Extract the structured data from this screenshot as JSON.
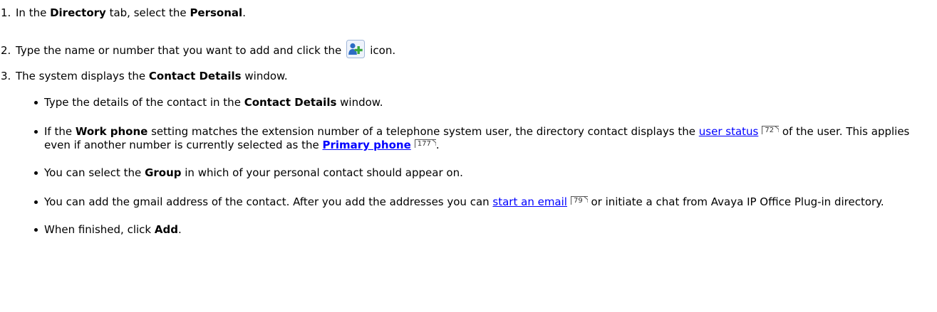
{
  "steps": [
    {
      "number": "1.",
      "text1": "In the ",
      "bold1": "Directory",
      "text2": " tab, select the ",
      "bold2": "Personal",
      "text3": "."
    },
    {
      "number": "2.",
      "text1": "Type the name or number that you want to add and click the",
      "icon": "add-contact-icon",
      "text2": "icon."
    },
    {
      "number": "3.",
      "text1": "The system displays the ",
      "bold1": "Contact Details",
      "text2": " window."
    }
  ],
  "bullets": [
    {
      "text1": "Type the details of the contact in the ",
      "bold1": "Contact Details",
      "text2": " window."
    },
    {
      "text1": "If the ",
      "bold1": "Work phone",
      "text2": " setting matches the extension number of a telephone system user, the directory contact displays the ",
      "link1": "user status",
      "ref1": "72",
      "text3": " of the user. This applies even if another number is currently selected as the ",
      "link2": "Primary phone",
      "ref2": "177",
      "text4": "."
    },
    {
      "text1": "You can select the ",
      "bold1": "Group",
      "text2": " in which of your personal contact should appear on."
    },
    {
      "text1": "You can add the gmail address of the contact. After you add the addresses you can ",
      "link1": "start an email",
      "ref1": "79",
      "text2": " or initiate a chat from Avaya IP Office Plug-in directory."
    },
    {
      "text1": "When finished, click ",
      "bold1": "Add",
      "text2": "."
    }
  ],
  "colors": {
    "link": "#0000ff",
    "text": "#000000",
    "icon_person": "#2b6cc4",
    "icon_plus": "#3aa83a"
  }
}
